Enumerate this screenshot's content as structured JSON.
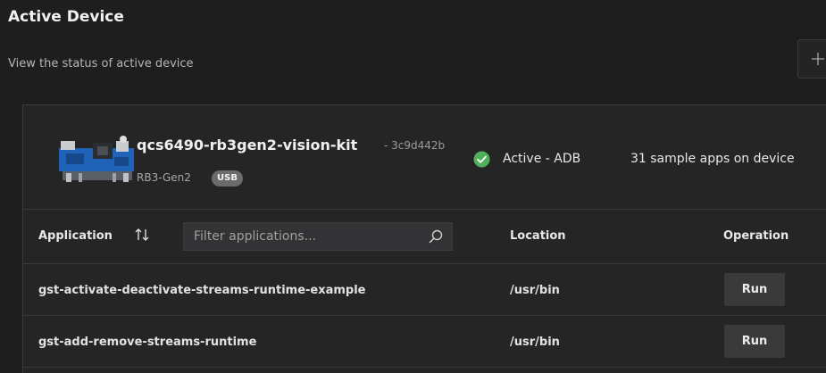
{
  "header": {
    "title": "Active Device",
    "subtitle": "View the status of active device",
    "add_icon": "plus-icon"
  },
  "device": {
    "name": "qcs6490-rb3gen2-vision-kit",
    "id": "- 3c9d442b",
    "model": "RB3-Gen2",
    "connection_badge": "USB",
    "status": "Active - ADB",
    "status_icon": "check-circle-icon",
    "status_color": "#4fb05a",
    "apps_count": "31 sample apps on device"
  },
  "table": {
    "columns": {
      "application": "Application",
      "location": "Location",
      "operation": "Operation"
    },
    "sort_icon": "sort-arrows-icon",
    "filter": {
      "placeholder": "Filter applications...",
      "value": ""
    },
    "rows": [
      {
        "application": "gst-activate-deactivate-streams-runtime-example",
        "location": "/usr/bin",
        "action": "Run"
      },
      {
        "application": "gst-add-remove-streams-runtime",
        "location": "/usr/bin",
        "action": "Run"
      }
    ]
  }
}
